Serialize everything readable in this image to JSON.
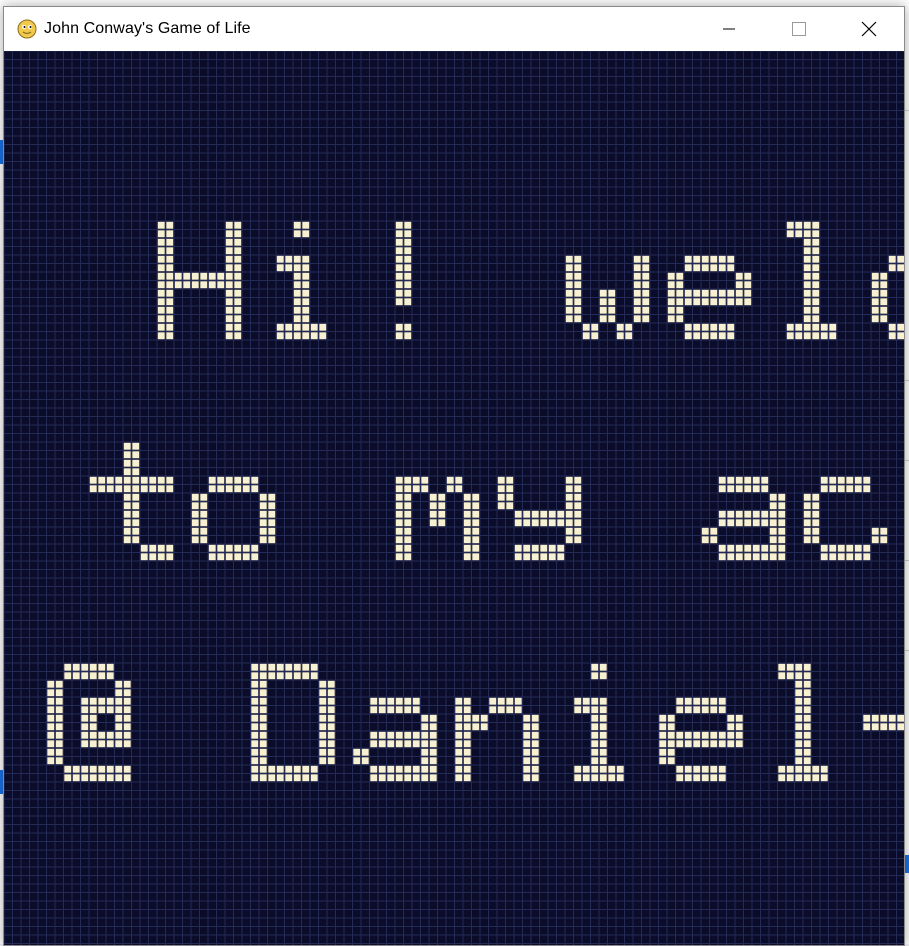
{
  "window": {
    "title": "John Conway's Game of Life",
    "icon": "python-snake-icon",
    "controls": [
      "minimize-icon",
      "maximize-icon",
      "close-icon"
    ]
  },
  "grid": {
    "background_color": "#0b0c2a",
    "grid_line_color": "#232a55",
    "alive_cell_color": "#f7f1d2",
    "rows": [
      "Hi! welcome",
      "to my account",
      "@ Daniel-Ayz"
    ]
  },
  "colors": {
    "titlebar": "#ffffff",
    "title_text": "#000000"
  }
}
